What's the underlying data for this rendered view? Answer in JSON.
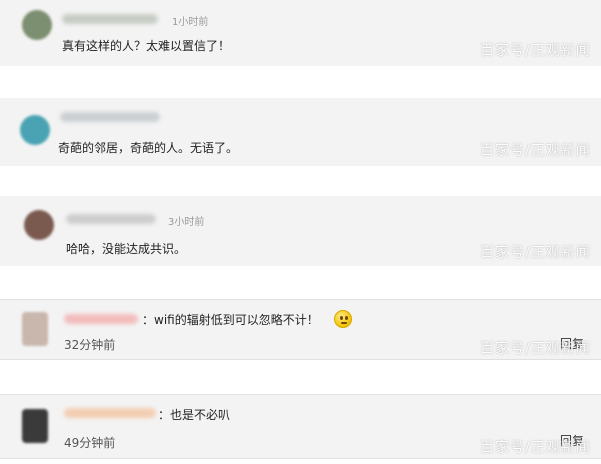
{
  "comments": [
    {
      "time": "1小时前",
      "content": "真有这样的人？太难以置信了！",
      "watermark": "百家号/正观新闻",
      "colors": {
        "avatar": "#7c8f70",
        "name": "#bfc6bb"
      }
    },
    {
      "content": "奇葩的邻居，奇葩的人。无语了。",
      "watermark": "百家号/正观新闻",
      "colors": {
        "avatar": "#4aa3b3",
        "name": "#c4c9cc"
      }
    },
    {
      "time": "3小时前",
      "content": "哈哈，没能达成共识。",
      "watermark": "百家号/正观新闻",
      "colors": {
        "avatar": "#7a5a4f",
        "name": "#c7c7c7"
      }
    },
    {
      "content": "：wifi的辐射低到可以忽略不计！",
      "time": "32分钟前",
      "reply": "回复",
      "watermark": "百家号/正观新闻",
      "emoji": "thinking-face-icon",
      "colors": {
        "avatar": "#c9b7ad",
        "name": "#f2b2b2"
      }
    },
    {
      "content": "：也是不必叭",
      "time": "49分钟前",
      "reply": "回复",
      "watermark": "百家号/正观新闻",
      "colors": {
        "avatar": "#3a3a3a",
        "name": "#f3c7a6"
      }
    }
  ]
}
